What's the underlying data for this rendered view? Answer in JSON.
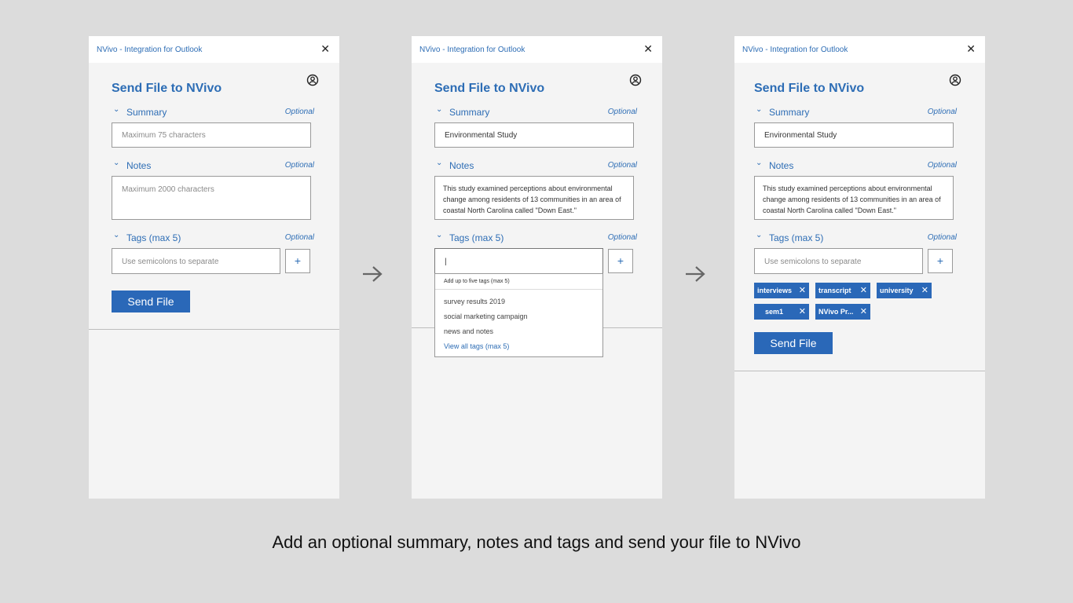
{
  "panels": [
    {
      "window_title": "NVivo - Integration for Outlook",
      "close_glyph": "✕",
      "heading": "Send File to NVivo",
      "summary": {
        "label": "Summary",
        "optional": "Optional",
        "placeholder": "Maximum 75 characters",
        "value": ""
      },
      "notes": {
        "label": "Notes",
        "optional": "Optional",
        "placeholder": "Maximum 2000 characters",
        "value": ""
      },
      "tags": {
        "label": "Tags (max 5)",
        "optional": "Optional",
        "placeholder": "Use semicolons to separate",
        "add_label": "+"
      },
      "send_label": "Send File"
    },
    {
      "window_title": "NVivo - Integration for Outlook",
      "close_glyph": "✕",
      "heading": "Send File to NVivo",
      "summary": {
        "label": "Summary",
        "optional": "Optional",
        "value": "Environmental Study"
      },
      "notes": {
        "label": "Notes",
        "optional": "Optional",
        "value": "This study examined perceptions about environmental change among residents of 13 communities in an area of coastal North Carolina called \"Down East.\""
      },
      "tags": {
        "label": "Tags (max 5)",
        "optional": "Optional",
        "input_value": "|",
        "add_label": "+"
      },
      "dropdown": {
        "hint": "Add up to five tags (max 5)",
        "items": [
          "survey results 2019",
          "social marketing campaign",
          "news and notes"
        ],
        "view_all": "View all tags (max 5)"
      }
    },
    {
      "window_title": "NVivo - Integration for Outlook",
      "close_glyph": "✕",
      "heading": "Send File to NVivo",
      "summary": {
        "label": "Summary",
        "optional": "Optional",
        "value": "Environmental Study"
      },
      "notes": {
        "label": "Notes",
        "optional": "Optional",
        "value": "This study examined perceptions about environmental change among residents of 13 communities in an area of coastal North Carolina called \"Down East.\""
      },
      "tags": {
        "label": "Tags (max 5)",
        "optional": "Optional",
        "placeholder": "Use semicolons to separate",
        "add_label": "+"
      },
      "chips": [
        "interviews",
        "transcript",
        "university",
        "sem1",
        "NVivo Pr..."
      ],
      "chip_remove_glyph": "✕",
      "send_label": "Send File"
    }
  ],
  "chevron_glyph": "⌄",
  "caption": "Add an optional summary, notes and tags and send your file to NVivo",
  "colors": {
    "accent": "#2d6db5",
    "button": "#2a68b8",
    "panel": "#f4f4f4",
    "background": "#dcdcdc"
  }
}
